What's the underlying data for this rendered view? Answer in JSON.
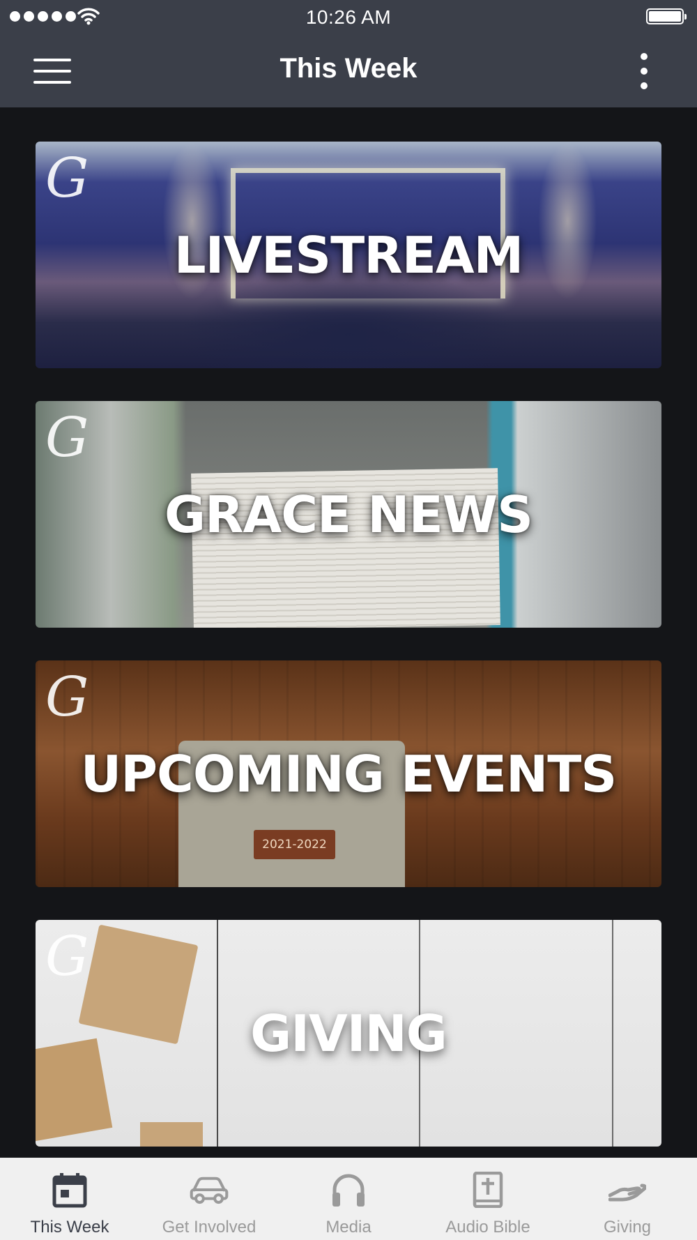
{
  "status_bar": {
    "time": "10:26 AM"
  },
  "header": {
    "title": "This Week"
  },
  "cards": [
    {
      "label": "LIVESTREAM",
      "logo": "G"
    },
    {
      "label": "GRACE NEWS",
      "logo": "G"
    },
    {
      "label": "UPCOMING EVENTS",
      "logo": "G",
      "tag": "2021-2022"
    },
    {
      "label": "GIVING",
      "logo": "G"
    }
  ],
  "tabs": [
    {
      "label": "This Week",
      "icon": "calendar-icon",
      "active": true
    },
    {
      "label": "Get Involved",
      "icon": "car-icon",
      "active": false
    },
    {
      "label": "Media",
      "icon": "headphones-icon",
      "active": false
    },
    {
      "label": "Audio Bible",
      "icon": "bible-icon",
      "active": false
    },
    {
      "label": "Giving",
      "icon": "giving-hand-icon",
      "active": false
    }
  ],
  "colors": {
    "header_bg": "#3b3f49",
    "page_bg": "#141518",
    "tabbar_bg": "#f0f0f0",
    "tab_active": "#3b3f49",
    "tab_inactive": "#9a9a9a"
  }
}
